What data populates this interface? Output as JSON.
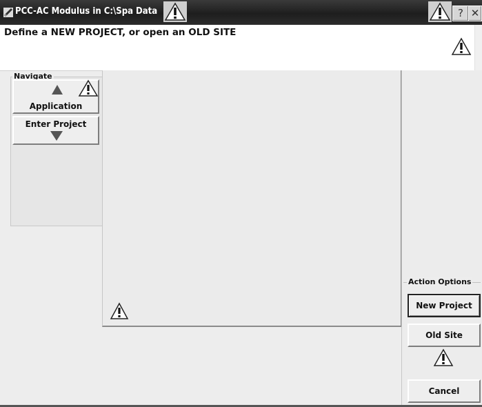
{
  "window": {
    "title": "PCC-AC Modulus in C:\\Spa Data",
    "help_label": "?",
    "close_label": "✕"
  },
  "message": {
    "text": "Define a NEW PROJECT, or open an OLD SITE"
  },
  "navigate": {
    "group_label": "Navigate",
    "application_label": "Application",
    "enter_project_label": "Enter Project"
  },
  "actions": {
    "group_label": "Action Options",
    "new_project_label": "New Project",
    "old_site_label": "Old Site",
    "cancel_label": "Cancel"
  },
  "icons": {
    "app": "pencil-ruler-icon",
    "warning": "warning-triangle-icon",
    "up": "triangle-up-icon",
    "down": "triangle-down-icon"
  },
  "colors": {
    "titlebar": "#1e1e1e",
    "face": "#ededed",
    "arrow": "#555555"
  }
}
